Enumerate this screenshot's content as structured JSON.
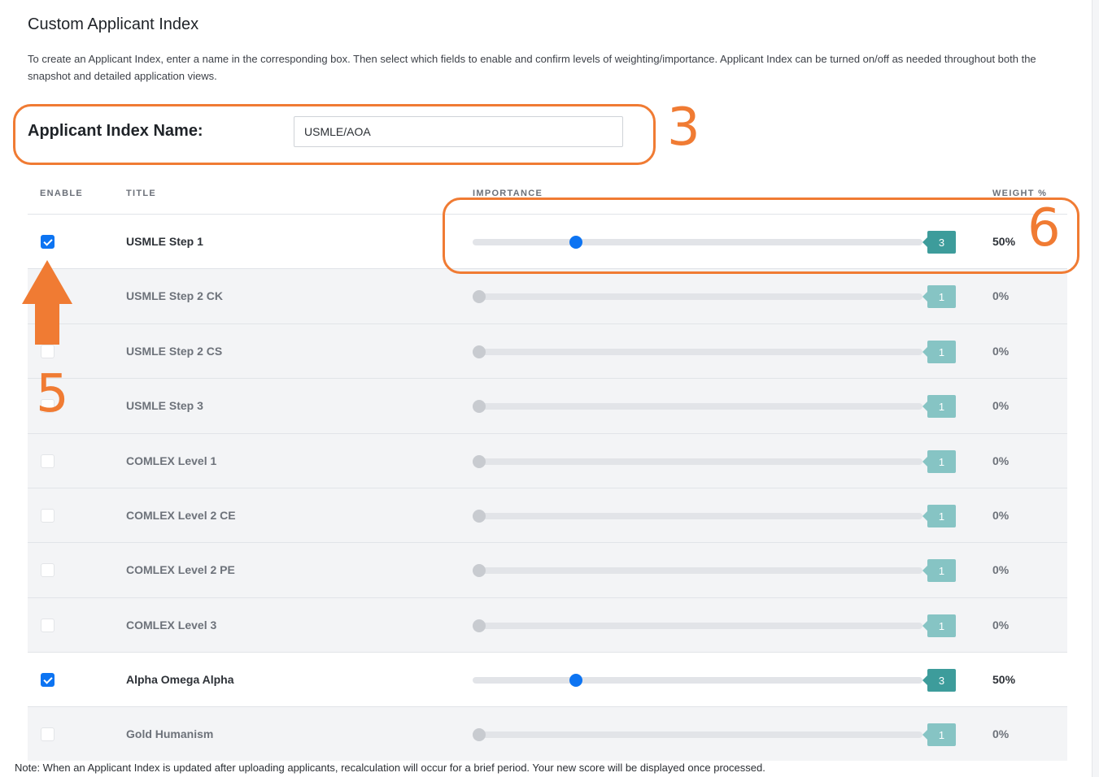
{
  "page": {
    "title": "Custom Applicant Index",
    "description": "To create an Applicant Index, enter a name in the corresponding box. Then select which fields to enable and confirm levels of weighting/importance. Applicant Index can be turned on/off as needed throughout both the snapshot and detailed application views.",
    "index_name_label": "Applicant Index Name:",
    "index_name_value": "USMLE/AOA",
    "note": "Note: When an Applicant Index is updated after uploading applicants, recalculation will occur for a brief period. Your new score will be displayed once processed."
  },
  "table": {
    "headers": {
      "enable": "ENABLE",
      "title": "TITLE",
      "importance": "IMPORTANCE",
      "weight": "WEIGHT %"
    },
    "importance_max": 10,
    "rows": [
      {
        "enabled": true,
        "title": "USMLE Step 1",
        "importance": 3,
        "importance_label": "3",
        "weight": "50%"
      },
      {
        "enabled": false,
        "title": "USMLE Step 2 CK",
        "importance": 1,
        "importance_label": "1",
        "weight": "0%"
      },
      {
        "enabled": false,
        "title": "USMLE Step 2 CS",
        "importance": 1,
        "importance_label": "1",
        "weight": "0%"
      },
      {
        "enabled": false,
        "title": "USMLE Step 3",
        "importance": 1,
        "importance_label": "1",
        "weight": "0%"
      },
      {
        "enabled": false,
        "title": "COMLEX Level 1",
        "importance": 1,
        "importance_label": "1",
        "weight": "0%"
      },
      {
        "enabled": false,
        "title": "COMLEX Level 2 CE",
        "importance": 1,
        "importance_label": "1",
        "weight": "0%"
      },
      {
        "enabled": false,
        "title": "COMLEX Level 2 PE",
        "importance": 1,
        "importance_label": "1",
        "weight": "0%"
      },
      {
        "enabled": false,
        "title": "COMLEX Level 3",
        "importance": 1,
        "importance_label": "1",
        "weight": "0%"
      },
      {
        "enabled": true,
        "title": "Alpha Omega Alpha",
        "importance": 3,
        "importance_label": "3",
        "weight": "50%"
      },
      {
        "enabled": false,
        "title": "Gold Humanism",
        "importance": 1,
        "importance_label": "1",
        "weight": "0%"
      }
    ]
  },
  "annotations": {
    "name_callout": "3",
    "enable_callout": "5",
    "importance_callout": "6",
    "color": "#f07b33"
  },
  "colors": {
    "accent": "#0d74f2",
    "tag_active": "#3d9c9b",
    "tag_inactive": "#86c4c4"
  }
}
